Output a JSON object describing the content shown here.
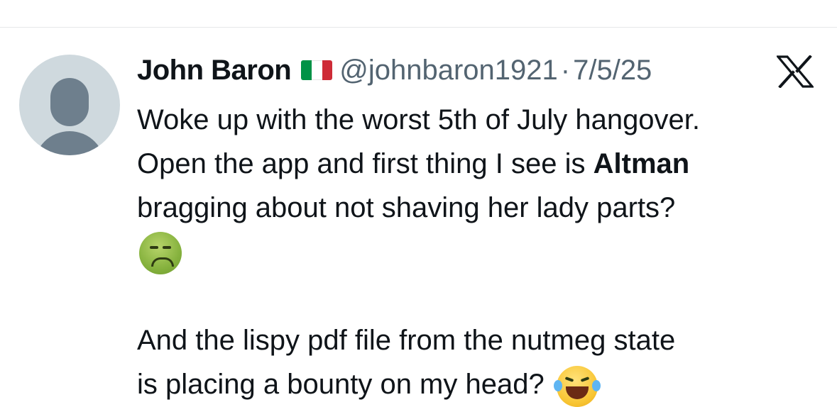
{
  "tweet": {
    "author": {
      "display_name": "John Baron",
      "flag_icon": "italy-flag-icon",
      "handle": "@johnbaron1921",
      "separator": "·",
      "date": "7/5/25"
    },
    "platform_icon": "x-logo-icon",
    "body": {
      "line1": "Woke up with the worst 5th of July hangover.",
      "line2_before": "Open the app and first thing I see is ",
      "line2_bold": "Altman",
      "line3": "bragging about not shaving her lady parts?",
      "emoji1": "nauseated-face-emoji",
      "line4": "And the lispy pdf file from the nutmeg state",
      "line5": "is placing a bounty on my head?",
      "emoji2": "face-with-tears-of-joy-emoji"
    }
  },
  "colors": {
    "text_primary": "#0f1419",
    "text_secondary": "#536471",
    "avatar_bg": "#cfd9de",
    "avatar_fg": "#6e7f8d",
    "flag_green": "#009246",
    "flag_white": "#ffffff",
    "flag_red": "#ce2b37"
  }
}
